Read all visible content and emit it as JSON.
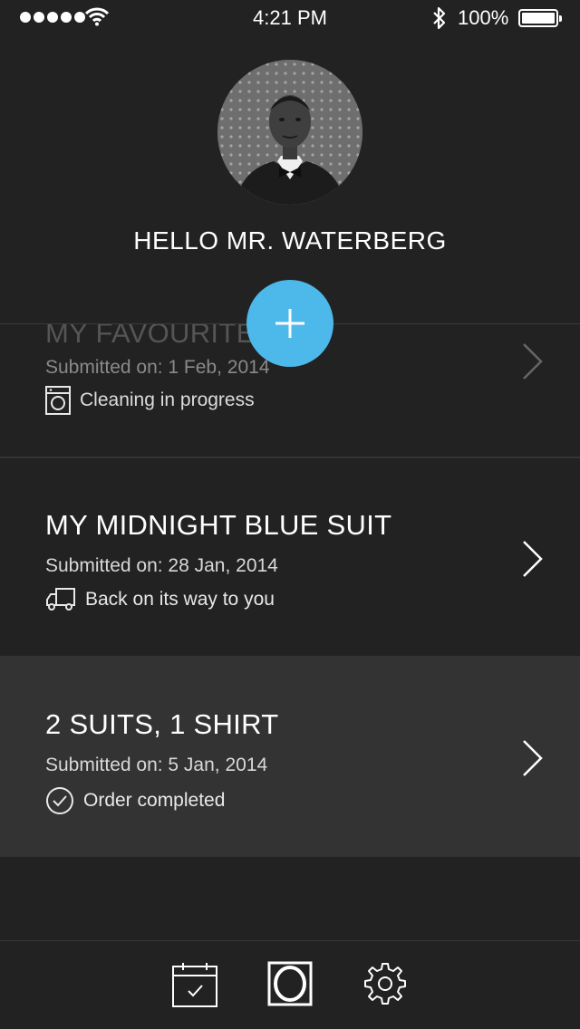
{
  "status_bar": {
    "time": "4:21 PM",
    "battery": "100%",
    "icons": [
      "signal-dots-icon",
      "wifi-icon",
      "bluetooth-icon",
      "battery-icon"
    ]
  },
  "header": {
    "greeting": "HELLO MR. WATERBERG"
  },
  "orders": [
    {
      "title": "MY FAVOURITE",
      "submitted": "Submitted on: 1 Feb, 2014",
      "status": "Cleaning in progress",
      "status_icon": "washing-machine-icon"
    },
    {
      "title": "MY MIDNIGHT BLUE SUIT",
      "submitted": "Submitted on: 28 Jan, 2014",
      "status": "Back on its way to you",
      "status_icon": "delivery-truck-icon"
    },
    {
      "title": "2 SUITS, 1 SHIRT",
      "submitted": "Submitted on: 5 Jan, 2014",
      "status": "Order completed",
      "status_icon": "check-circle-icon"
    }
  ],
  "tab_bar": {
    "items": [
      "calendar-check-icon",
      "washer-icon",
      "gear-icon"
    ],
    "active": "washer-icon"
  },
  "colors": {
    "background": "#222222",
    "highlight_row": "#333333",
    "accent": "#4db8ea"
  }
}
